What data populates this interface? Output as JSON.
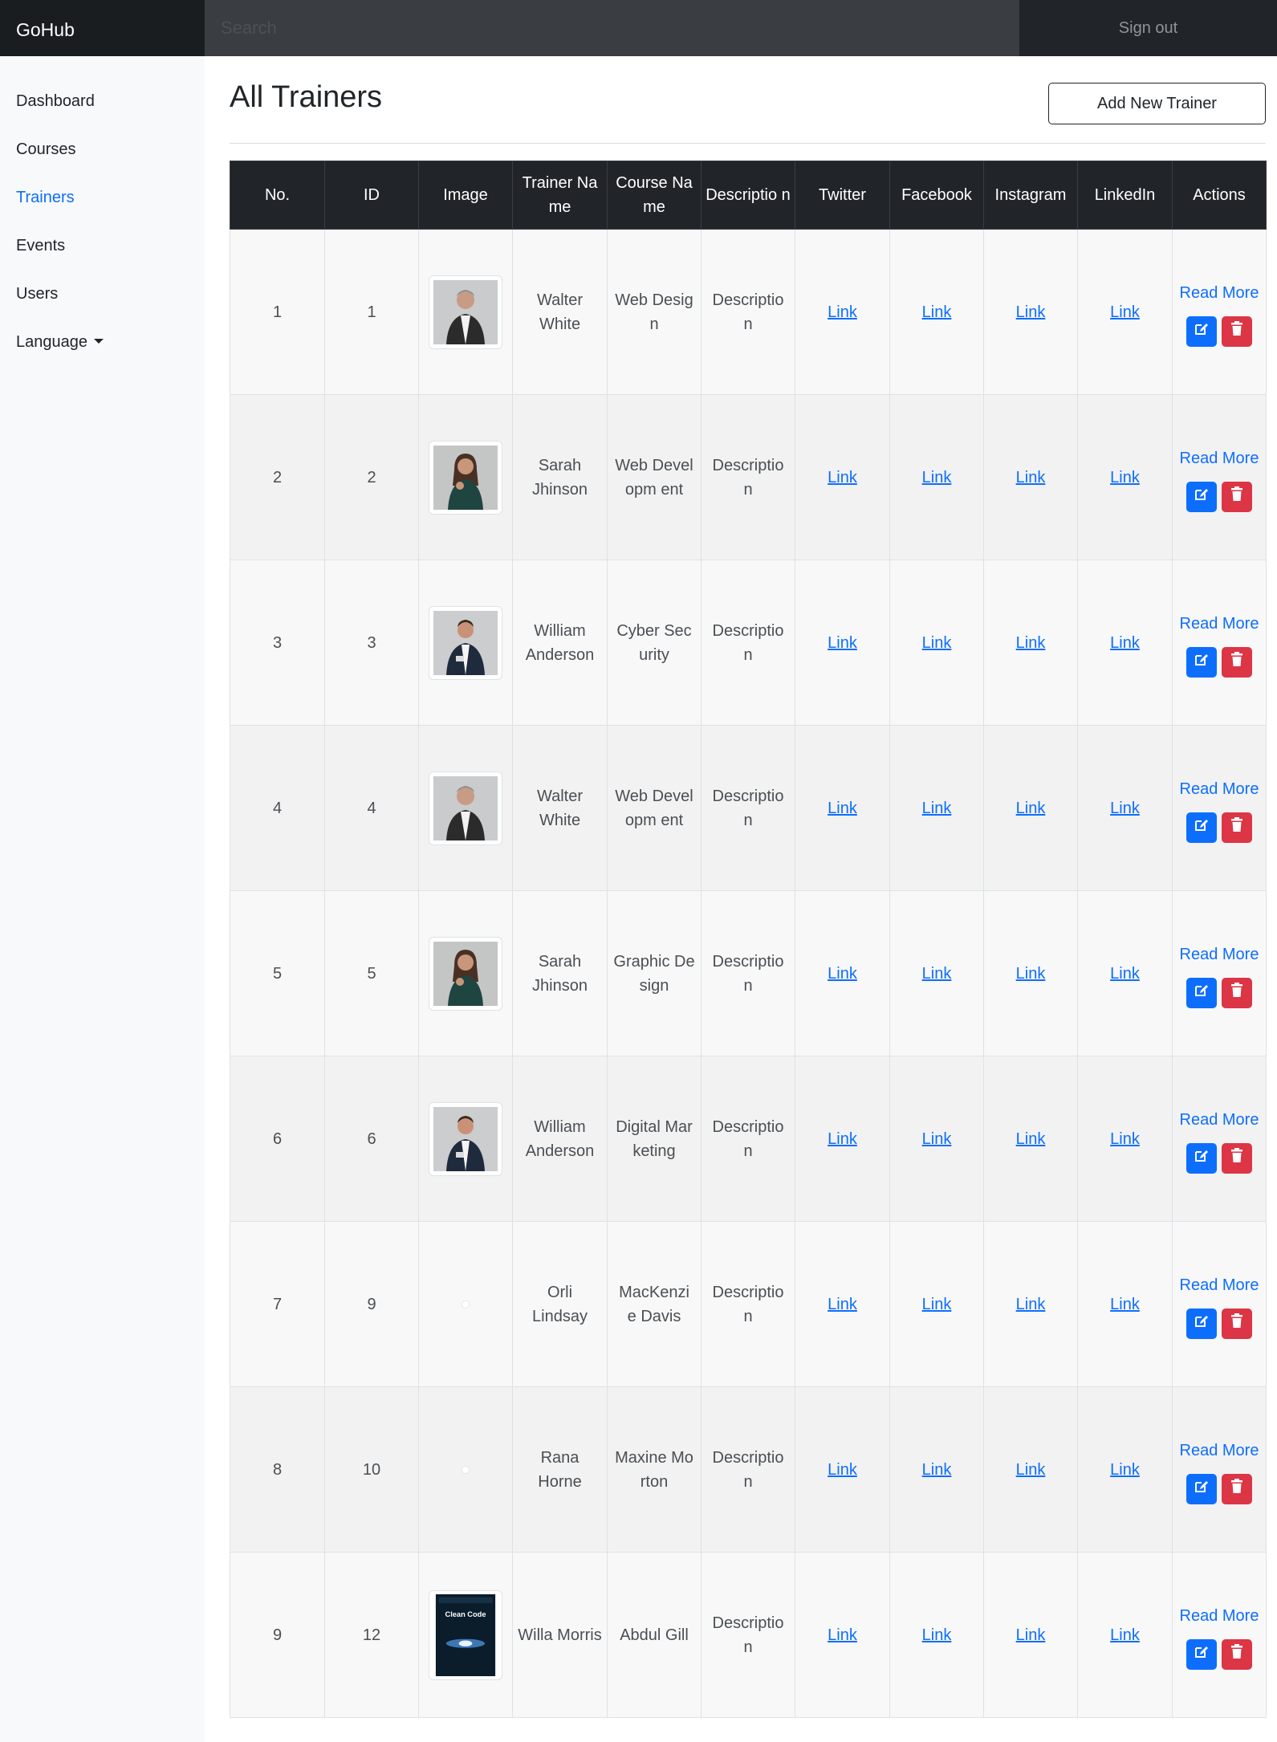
{
  "navbar": {
    "brand": "GoHub",
    "search_placeholder": "Search",
    "signout": "Sign out"
  },
  "sidebar": {
    "items": [
      {
        "label": "Dashboard"
      },
      {
        "label": "Courses"
      },
      {
        "label": "Trainers",
        "active": true
      },
      {
        "label": "Events"
      },
      {
        "label": "Users"
      },
      {
        "label": "Language"
      }
    ]
  },
  "main": {
    "title": "All Trainers",
    "add_button": "Add New Trainer"
  },
  "table": {
    "columns": [
      "No.",
      "ID",
      "Image",
      "Trainer Name",
      "Course Name",
      "Descriptio n",
      "Twitter",
      "Facebook",
      "Instagram",
      "LinkedIn",
      "Actions"
    ],
    "link_label": "Link",
    "read_more": "Read More",
    "rows": [
      {
        "no": "1",
        "id": "1",
        "image": "man-gray-suit",
        "name": "Walter White",
        "course": "Web Design",
        "description": "Descriptio n"
      },
      {
        "no": "2",
        "id": "2",
        "image": "woman-dark-dress",
        "name": "Sarah Jhinson",
        "course": "Web Developm ent",
        "description": "Descriptio n"
      },
      {
        "no": "3",
        "id": "3",
        "image": "man-navy-suit",
        "name": "William Anderson",
        "course": "Cyber Security",
        "description": "Descriptio n"
      },
      {
        "no": "4",
        "id": "4",
        "image": "man-gray-suit",
        "name": "Walter White",
        "course": "Web Developm ent",
        "description": "Descriptio n"
      },
      {
        "no": "5",
        "id": "5",
        "image": "woman-dark-dress",
        "name": "Sarah Jhinson",
        "course": "Graphic Design",
        "description": "Descriptio n"
      },
      {
        "no": "6",
        "id": "6",
        "image": "man-navy-suit",
        "name": "William Anderson",
        "course": "Digital Marketing",
        "description": "Descriptio n"
      },
      {
        "no": "7",
        "id": "9",
        "image": "broken",
        "name": "Orli Lindsay",
        "course": "MacKenzi e Davis",
        "description": "Descriptio n"
      },
      {
        "no": "8",
        "id": "10",
        "image": "broken",
        "name": "Rana Horne",
        "course": "Maxine Morton",
        "description": "Descriptio n"
      },
      {
        "no": "9",
        "id": "12",
        "image": "book-cover",
        "name": "Willa Morris",
        "course": "Abdul Gill",
        "description": "Descriptio n"
      }
    ]
  },
  "book_cover_title": "Clean Code",
  "colors": {
    "primary": "#0d6efd",
    "danger": "#dc3545",
    "dark": "#212529"
  }
}
